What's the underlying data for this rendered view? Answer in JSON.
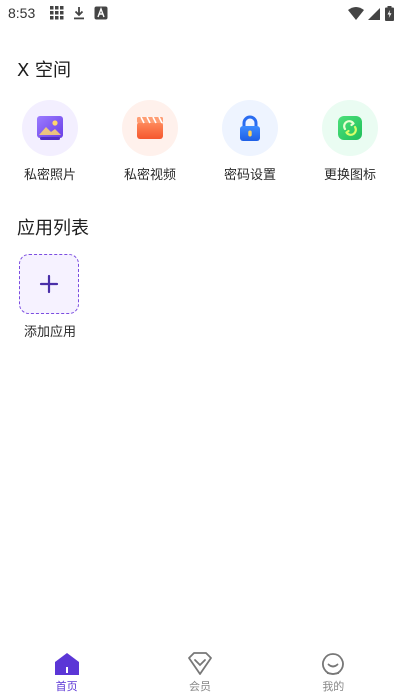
{
  "status_bar": {
    "time": "8:53"
  },
  "sections": {
    "x_space_title": "X 空间",
    "app_list_title": "应用列表"
  },
  "features": [
    {
      "label": "私密照片",
      "icon": "photo-icon"
    },
    {
      "label": "私密视频",
      "icon": "video-icon"
    },
    {
      "label": "密码设置",
      "icon": "lock-icon"
    },
    {
      "label": "更换图标",
      "icon": "swap-icon"
    }
  ],
  "apps": {
    "add_label": "添加应用"
  },
  "bottom_nav": [
    {
      "label": "首页",
      "icon": "home-icon",
      "active": true
    },
    {
      "label": "会员",
      "icon": "vip-icon",
      "active": false
    },
    {
      "label": "我的",
      "icon": "profile-icon",
      "active": false
    }
  ],
  "colors": {
    "accent": "#5b36d6",
    "text": "#222222",
    "muted": "#888888"
  }
}
